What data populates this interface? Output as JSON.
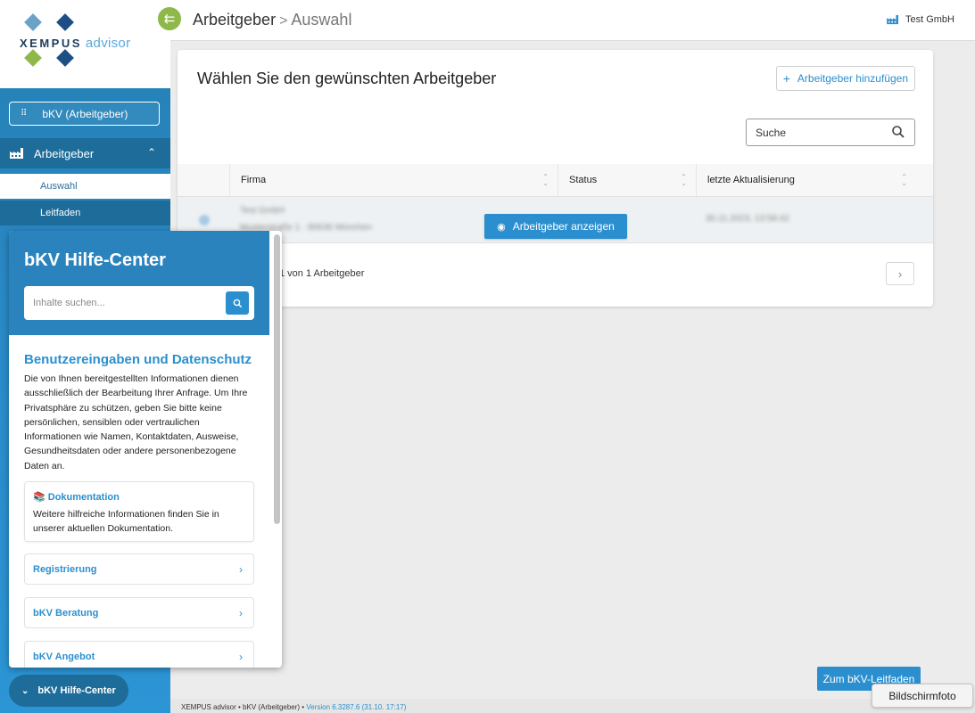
{
  "logo": {
    "brand": "XEMPUS",
    "product": "advisor"
  },
  "sidebar": {
    "switch_label": "bKV (Arbeitgeber)",
    "group_label": "Arbeitgeber",
    "items": [
      {
        "label": "Auswahl",
        "active": true
      },
      {
        "label": "Leitfaden",
        "active": false
      }
    ],
    "help_toggle_label": "bKV Hilfe-Center"
  },
  "header": {
    "crumb_root": "Arbeitgeber",
    "crumb_sep": ">",
    "crumb_current": "Auswahl",
    "company": "Test GmbH"
  },
  "card": {
    "title": "Wählen Sie den gewünschten Arbeitgeber",
    "add_button": "Arbeitgeber hinzufügen",
    "search_value": "Suche",
    "columns": [
      "Firma",
      "Status",
      "letzte Aktualisierung"
    ],
    "row": {
      "name": "Test GmbH",
      "address": "Musterstraße 1 · 80636 München",
      "updated": "30.11.2023, 13:58:42"
    },
    "view_button": "Arbeitgeber anzeigen",
    "pager_text": "1 von 1 Arbeitgeber"
  },
  "help": {
    "title": "bKV Hilfe-Center",
    "search_placeholder": "Inhalte suchen...",
    "privacy_heading": "Benutzereingaben und Datenschutz",
    "privacy_text": "Die von Ihnen bereitgestellten Informationen dienen ausschließlich der Bearbeitung Ihrer Anfrage. Um Ihre Privatsphäre zu schützen, geben Sie bitte keine persönlichen, sensiblen oder vertraulichen Informationen wie Namen, Kontaktdaten, Ausweise, Gesundheitsdaten oder andere personenbezogene Daten an.",
    "doc_heading": "Dokumentation",
    "doc_text": "Weitere hilfreiche Informationen finden Sie in unserer aktuellen Dokumentation.",
    "links": [
      "Registrierung",
      "bKV Beratung",
      "bKV Angebot"
    ]
  },
  "footer": {
    "text": "XEMPUS advisor • bKV (Arbeitgeber) • ",
    "version": "Version 6.3287.6 (31.10. 17:17)"
  },
  "leitfaden_button": "Zum bKV-Leitfaden",
  "tooltip": "Bildschirmfoto",
  "colors": {
    "primary": "#2b8fcf",
    "sidebar": "#2580b3",
    "sidebar_dark": "#1d6c9a",
    "green": "#8fb84a"
  }
}
